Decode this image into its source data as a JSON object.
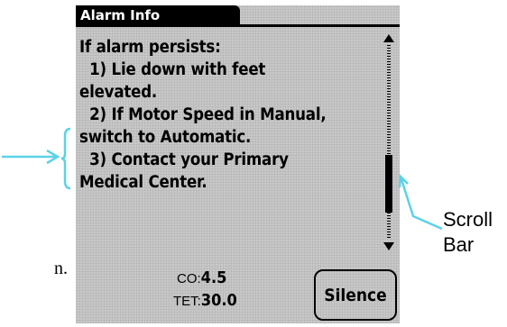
{
  "screen": {
    "title": "Alarm Info",
    "message_lines": [
      "If alarm persists:",
      "  1) Lie down with feet",
      "elevated.",
      "  2) If Motor Speed in Manual,",
      "switch to Automatic.",
      "  3) Contact your Primary",
      "Medical Center."
    ],
    "readouts": {
      "co_label": "CO:",
      "co_value": "4.5",
      "tet_label": "TET:",
      "tet_value": "30.0"
    },
    "silence_label": "Silence",
    "scroll_position": 0.8
  },
  "annotations": {
    "scroll_label_line1": "Scroll",
    "scroll_label_line2": "Bar",
    "stray_fragment": "n.",
    "annotation_color": "#5bd2e8"
  }
}
